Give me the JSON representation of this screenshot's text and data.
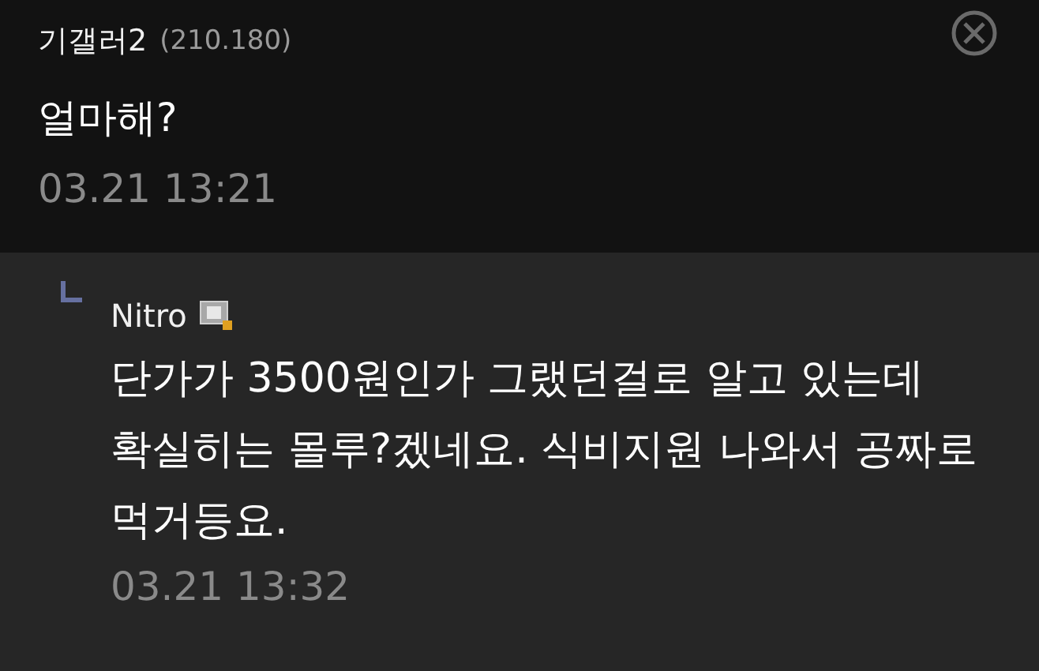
{
  "comment": {
    "author": "기갤러2",
    "ip": "(210.180)",
    "text": "얼마해?",
    "time": "03.21 13:21"
  },
  "reply": {
    "author": "Nitro",
    "text": "단가가 3500원인가 그랬던걸로 알고 있는데 확실히는 몰루?겠네요. 식비지원 나와서 공짜로 먹거등요.",
    "time": "03.21 13:32"
  }
}
